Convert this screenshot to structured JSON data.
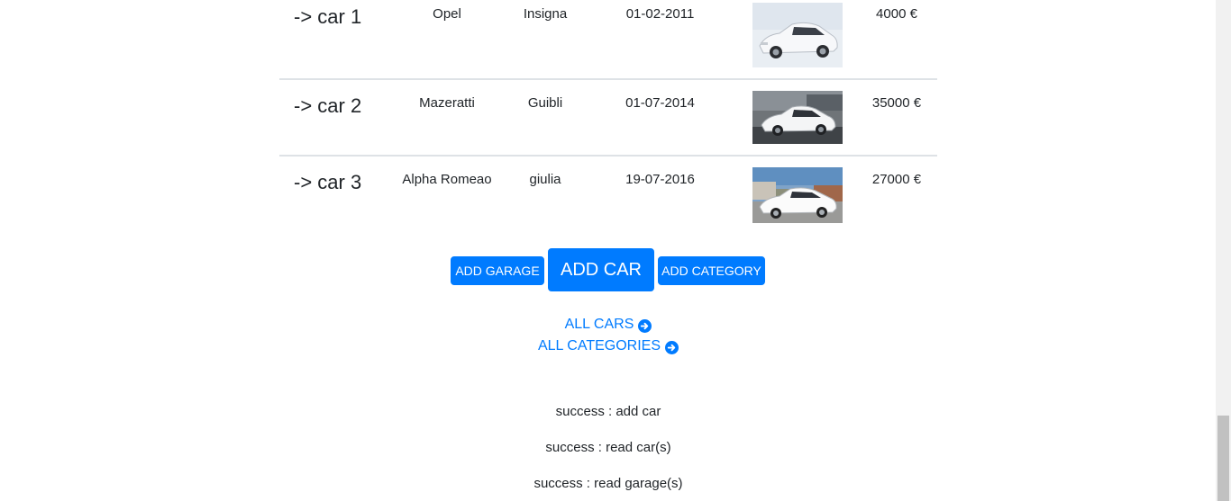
{
  "cars": [
    {
      "label": "-> car 1",
      "make": "Opel",
      "model": "Insigna",
      "date": "01-02-2011",
      "price": "4000 €",
      "image": "white-sedan-photo"
    },
    {
      "label": "-> car 2",
      "make": "Mazeratti",
      "model": "Guibli",
      "date": "01-07-2014",
      "price": "35000 €",
      "image": "white-sedan-photo"
    },
    {
      "label": "-> car 3",
      "make": "Alpha Romeao",
      "model": "giulia",
      "date": "19-07-2016",
      "price": "27000 €",
      "image": "white-sedan-photo"
    }
  ],
  "buttons": {
    "add_garage": "ADD GARAGE",
    "add_car": "ADD CAR",
    "add_category": "ADD CATEGORY"
  },
  "links": {
    "all_cars": "ALL CARS",
    "all_categories": "ALL CATEGORIES",
    "icon": "arrow-circle-right-icon"
  },
  "messages": [
    "success : add car",
    "success : read car(s)",
    "success : read garage(s)"
  ],
  "colors": {
    "primary": "#007bff",
    "text": "#212529",
    "divider": "#dee2e6"
  }
}
